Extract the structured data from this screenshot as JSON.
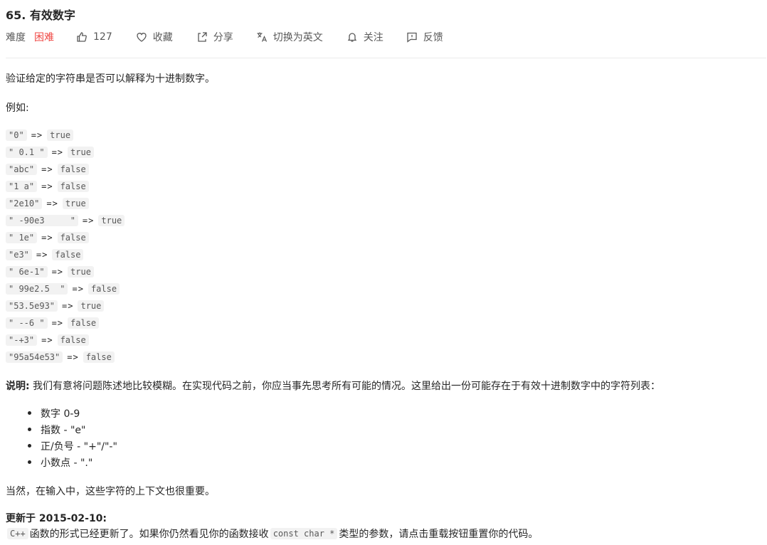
{
  "header": {
    "title": "65. 有效数字",
    "difficulty_label": "难度",
    "difficulty": "困难",
    "likes": "127",
    "favorite": "收藏",
    "share": "分享",
    "switch_lang": "切换为英文",
    "follow": "关注",
    "feedback": "反馈"
  },
  "body": {
    "intro": "验证给定的字符串是否可以解释为十进制数字。",
    "example_label": "例如:",
    "examples": [
      {
        "input": "\"0\"",
        "output": "true"
      },
      {
        "input": "\" 0.1 \"",
        "output": "true"
      },
      {
        "input": "\"abc\"",
        "output": "false"
      },
      {
        "input": "\"1 a\"",
        "output": "false"
      },
      {
        "input": "\"2e10\"",
        "output": "true"
      },
      {
        "input": "\" -90e3     \"",
        "output": "true"
      },
      {
        "input": "\" 1e\"",
        "output": "false"
      },
      {
        "input": "\"e3\"",
        "output": "false"
      },
      {
        "input": "\" 6e-1\"",
        "output": "true"
      },
      {
        "input": "\" 99e2.5  \"",
        "output": "false"
      },
      {
        "input": "\"53.5e93\"",
        "output": "true"
      },
      {
        "input": "\" --6 \"",
        "output": "false"
      },
      {
        "input": "\"-+3\"",
        "output": "false"
      },
      {
        "input": "\"95a54e53\"",
        "output": "false"
      }
    ],
    "arrow": "=>",
    "note_label": "说明:",
    "note_text": " 我们有意将问题陈述地比较模糊。在实现代码之前，你应当事先思考所有可能的情况。这里给出一份可能存在于有效十进制数字中的字符列表：",
    "chars": [
      "数字 0-9",
      "指数 - \"e\"",
      "正/负号 - \"+\"/\"-\"",
      "小数点 - \".\""
    ],
    "context_note": "当然，在输入中，这些字符的上下文也很重要。",
    "update_head": "更新于 2015-02-10:",
    "update_code1": "C++",
    "update_text1": "函数的形式已经更新了。如果你仍然看见你的函数接收",
    "update_code2": "const char *",
    "update_text2": "类型的参数，请点击重载按钮重置你的代码。"
  }
}
